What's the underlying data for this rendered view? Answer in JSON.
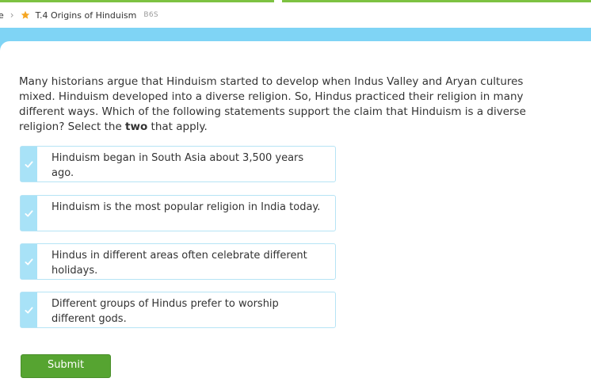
{
  "breadcrumb": {
    "previous": "e",
    "title": "T.4 Origins of Hinduism",
    "code": "B6S"
  },
  "question": {
    "text_before_bold": "Many historians argue that Hinduism started to develop when Indus Valley and Aryan cultures mixed. Hinduism developed into a diverse religion. So, Hindus practiced their religion in many different ways. Which of the following statements support the claim that Hinduism is a diverse religion? Select the ",
    "bold": "two",
    "text_after_bold": " that apply."
  },
  "choices": [
    {
      "text": "Hinduism began in South Asia about 3,500 years ago."
    },
    {
      "text": "Hinduism is the most popular religion in India today."
    },
    {
      "text": "Hindus in different areas often celebrate different holidays."
    },
    {
      "text": "Different groups of Hindus prefer to worship different gods."
    }
  ],
  "submit_label": "Submit",
  "colors": {
    "accent_green": "#7dc242",
    "band_blue": "#7fd4f5",
    "choice_tab": "#a8e2f7",
    "submit_green": "#56a431"
  }
}
